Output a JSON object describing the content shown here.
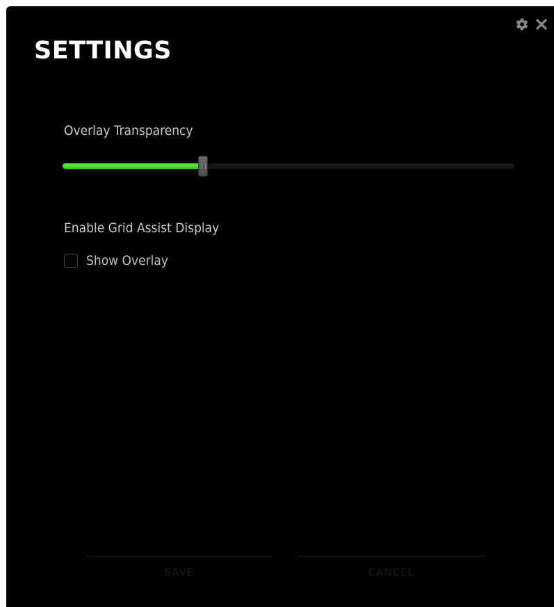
{
  "window": {
    "title": "SETTINGS",
    "icons": [
      "gear-icon",
      "close-icon"
    ]
  },
  "transparency": {
    "label": "Overlay Transparency",
    "value_fraction": 0.31,
    "fill_color": "#3ee020"
  },
  "grid_assist": {
    "label": "Enable Grid Assist Display",
    "checkbox_label": "Show Overlay",
    "checked": false
  },
  "footer": {
    "save_label": "SAVE",
    "cancel_label": "CANCEL"
  }
}
